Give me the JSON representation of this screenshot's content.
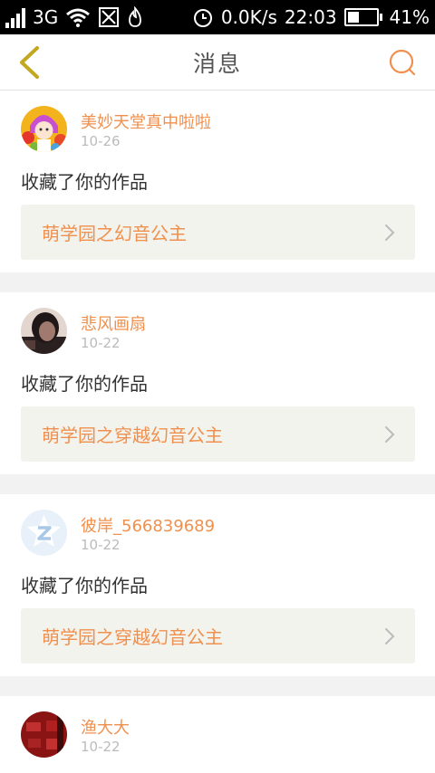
{
  "status_bar": {
    "network": "3G",
    "speed": "0.0K/s",
    "time": "22:03",
    "battery": "41%",
    "battery_level": 0.41,
    "icons": [
      "signal-icon",
      "wifi-icon",
      "sim-icon",
      "flame-icon",
      "alarm-icon",
      "battery-icon"
    ]
  },
  "header": {
    "title": "消息",
    "accent_color": "#f0904e",
    "back_icon": "chevron-left-icon",
    "search_icon": "search-icon"
  },
  "messages": [
    {
      "user": "美妙天堂真中啦啦",
      "date": "10-26",
      "action": "收藏了你的作品",
      "work": "萌学园之幻音公主"
    },
    {
      "user": "悲风画扇",
      "date": "10-22",
      "action": "收藏了你的作品",
      "work": "萌学园之穿越幻音公主"
    },
    {
      "user": "彼岸_566839689",
      "date": "10-22",
      "action": "收藏了你的作品",
      "work": "萌学园之穿越幻音公主"
    },
    {
      "user": "渔大大",
      "date": "10-22"
    }
  ]
}
